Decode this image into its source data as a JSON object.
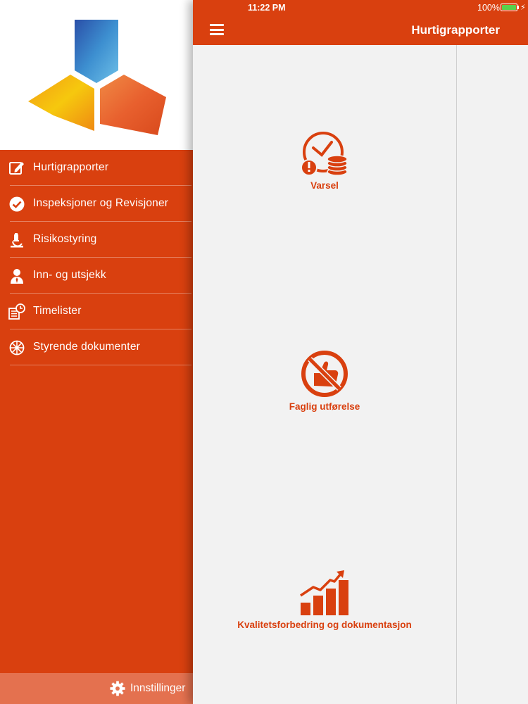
{
  "status_bar": {
    "time": "11:22 PM",
    "battery": "100%"
  },
  "header": {
    "title": "Hurtigrapporter"
  },
  "sidebar": {
    "items": [
      {
        "label": "Hurtigrapporter",
        "icon": "edit-icon"
      },
      {
        "label": "Inspeksjoner og Revisjoner",
        "icon": "check-circle-icon"
      },
      {
        "label": "Risikostyring",
        "icon": "microscope-icon"
      },
      {
        "label": "Inn- og utsjekk",
        "icon": "person-icon"
      },
      {
        "label": "Timelister",
        "icon": "timesheet-icon"
      },
      {
        "label": "Styrende dokumenter",
        "icon": "document-wheel-icon"
      }
    ],
    "settings_label": "Innstillinger"
  },
  "tiles": [
    {
      "label": "Varsel",
      "icon": "clock-warning-icon"
    },
    {
      "label": "Faglig utførelse",
      "icon": "no-thumbs-up-icon"
    },
    {
      "label": "Kvalitetsforbedring og dokumentasjon",
      "icon": "growth-chart-icon"
    }
  ],
  "colors": {
    "accent": "#d9400f",
    "panel": "#f2f2f2",
    "settings_bar": "#e4714f"
  }
}
